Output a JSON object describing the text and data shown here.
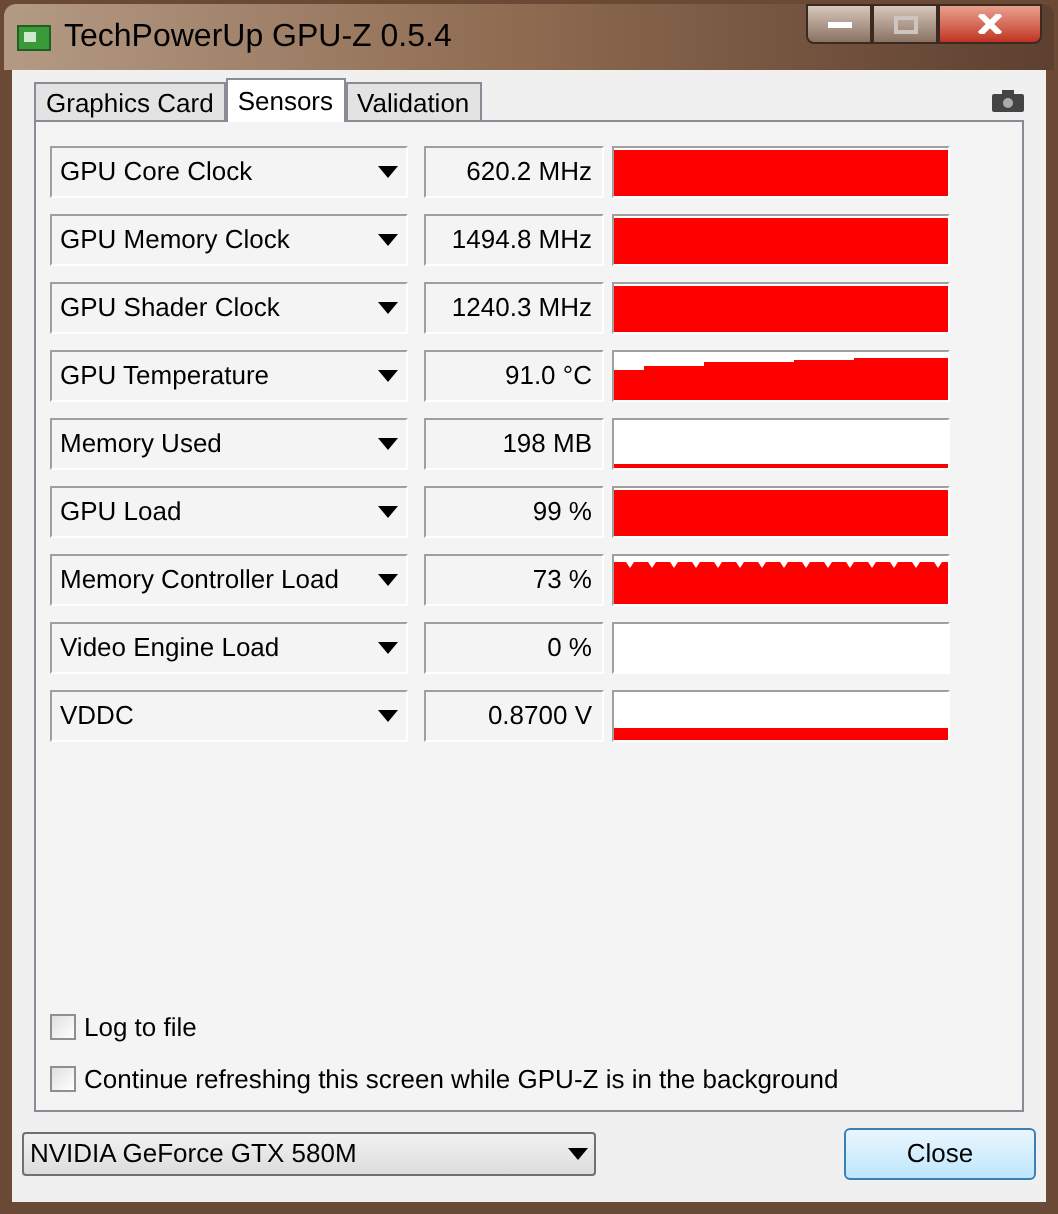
{
  "window": {
    "title": "TechPowerUp GPU-Z 0.5.4"
  },
  "tabs": [
    {
      "label": "Graphics Card",
      "selected": false
    },
    {
      "label": "Sensors",
      "selected": true
    },
    {
      "label": "Validation",
      "selected": false
    }
  ],
  "sensors": [
    {
      "name": "GPU Core Clock",
      "reading": "620.2 MHz"
    },
    {
      "name": "GPU Memory Clock",
      "reading": "1494.8 MHz"
    },
    {
      "name": "GPU Shader Clock",
      "reading": "1240.3 MHz"
    },
    {
      "name": "GPU Temperature",
      "reading": "91.0 °C"
    },
    {
      "name": "Memory Used",
      "reading": "198 MB"
    },
    {
      "name": "GPU Load",
      "reading": "99 %"
    },
    {
      "name": "Memory Controller Load",
      "reading": "73 %"
    },
    {
      "name": "Video Engine Load",
      "reading": "0 %"
    },
    {
      "name": "VDDC",
      "reading": "0.8700 V"
    }
  ],
  "options": [
    {
      "label": "Log to file",
      "checked": false
    },
    {
      "label": "Continue refreshing this screen while GPU-Z is in the background",
      "checked": false
    }
  ],
  "device_select": {
    "value": "NVIDIA GeForce GTX 580M"
  },
  "close_button": {
    "label": "Close"
  }
}
